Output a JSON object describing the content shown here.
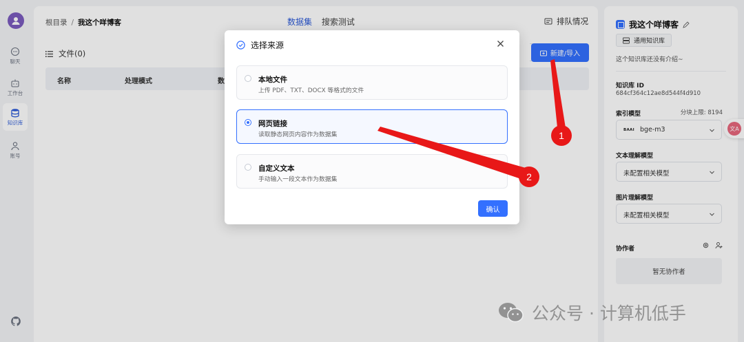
{
  "nav": {
    "items": [
      {
        "label": "聊天"
      },
      {
        "label": "工作台"
      },
      {
        "label": "知识库"
      },
      {
        "label": "账号"
      }
    ]
  },
  "header": {
    "breadcrumb_root": "根目录",
    "breadcrumb_sep": "/",
    "breadcrumb_current": "我这个咩博客",
    "tabs": [
      {
        "label": "数据集"
      },
      {
        "label": "搜索测试"
      }
    ],
    "queue_label": "排队情况"
  },
  "files": {
    "title": "文件(0)",
    "new_button": "新建/导入",
    "columns": [
      "名称",
      "处理模式",
      "数"
    ]
  },
  "dialog": {
    "title": "选择来源",
    "options": [
      {
        "title": "本地文件",
        "desc": "上传 PDF、TXT、DOCX 等格式的文件",
        "selected": false
      },
      {
        "title": "网页链接",
        "desc": "读取静态网页内容作为数据集",
        "selected": true
      },
      {
        "title": "自定义文本",
        "desc": "手动输入一段文本作为数据集",
        "selected": false
      }
    ],
    "confirm": "确认"
  },
  "kb": {
    "name": "我这个咩博客",
    "tag": "通用知识库",
    "desc": "这个知识库还没有介绍~",
    "id_label": "知识库 ID",
    "id_value": "684cf364c12ae8d544f4d910",
    "index_label": "索引模型",
    "chunk_limit": "分块上限: 8194",
    "index_brand": "BAAI",
    "index_model": "bge-m3",
    "text_model_label": "文本理解模型",
    "text_model_value": "未配置相关模型",
    "image_model_label": "图片理解模型",
    "image_model_value": "未配置相关模型",
    "collab_label": "协作者",
    "no_collab": "暂无协作者"
  },
  "float_badge": "文A",
  "watermark": "公众号 · 计算机低手",
  "annotations": [
    "1",
    "2"
  ],
  "colors": {
    "primary": "#3370ff",
    "annotation": "#e81818"
  }
}
